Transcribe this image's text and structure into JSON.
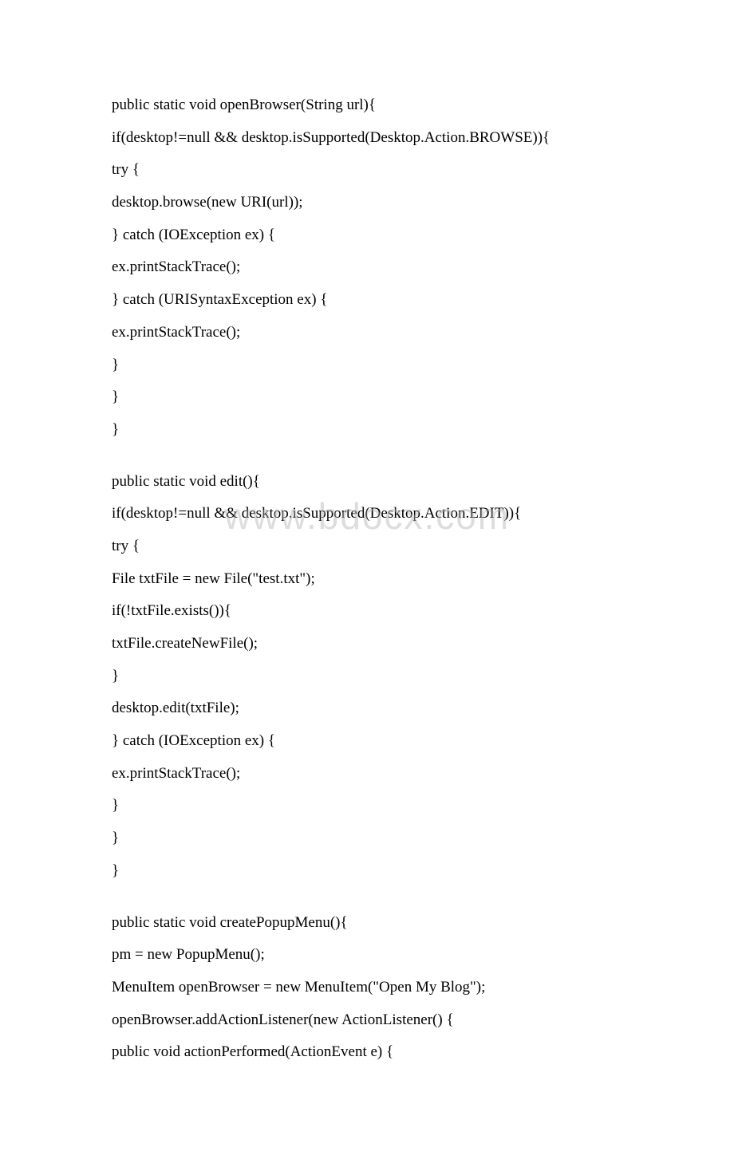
{
  "watermark": "www.bdocx.com",
  "code_lines": [
    "public static void openBrowser(String url){",
    "if(desktop!=null && desktop.isSupported(Desktop.Action.BROWSE)){",
    "try {",
    "desktop.browse(new URI(url));",
    "} catch (IOException ex) {",
    "ex.printStackTrace();",
    "} catch (URISyntaxException ex) {",
    "ex.printStackTrace();",
    "}",
    "}",
    "}",
    "",
    "public static void edit(){",
    "if(desktop!=null && desktop.isSupported(Desktop.Action.EDIT)){",
    "try {",
    "File txtFile = new File(\"test.txt\");",
    "if(!txtFile.exists()){",
    "txtFile.createNewFile();",
    "}",
    "desktop.edit(txtFile);",
    "} catch (IOException ex) {",
    "ex.printStackTrace();",
    "}",
    "}",
    "}",
    "",
    "public static void createPopupMenu(){",
    "pm = new PopupMenu();",
    "MenuItem openBrowser = new MenuItem(\"Open My Blog\");",
    "openBrowser.addActionListener(new ActionListener() {",
    "public void actionPerformed(ActionEvent e) {"
  ]
}
